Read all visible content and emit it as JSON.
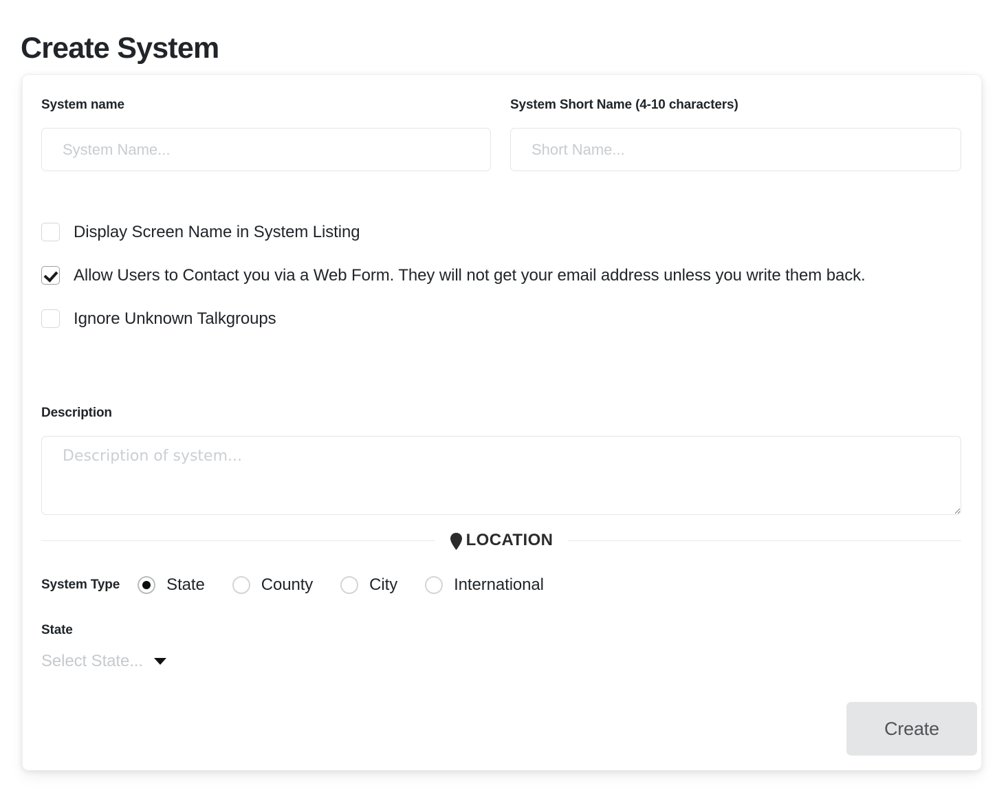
{
  "page": {
    "title": "Create System"
  },
  "form": {
    "system_name": {
      "label": "System name",
      "placeholder": "System Name...",
      "value": ""
    },
    "short_name": {
      "label": "System Short Name (4-10 characters)",
      "placeholder": "Short Name...",
      "value": ""
    },
    "checkboxes": [
      {
        "label": "Display Screen Name in System Listing",
        "checked": false
      },
      {
        "label": "Allow Users to Contact you via a Web Form. They will not get your email address unless you write them back.",
        "checked": true
      },
      {
        "label": "Ignore Unknown Talkgroups",
        "checked": false
      }
    ],
    "description": {
      "label": "Description",
      "placeholder": "Description of system...",
      "value": ""
    },
    "location_divider": {
      "label": "LOCATION",
      "icon": "map-pin-icon"
    },
    "system_type": {
      "label": "System Type",
      "selected": "State",
      "options": [
        "State",
        "County",
        "City",
        "International"
      ]
    },
    "state": {
      "label": "State",
      "placeholder": "Select State...",
      "value": "",
      "caret_icon": "chevron-down-icon"
    },
    "submit": {
      "label": "Create"
    }
  },
  "colors": {
    "page_background": "#ffffff",
    "card_background": "#ffffff",
    "text_primary": "#212529",
    "placeholder": "#c8cccf",
    "border": "#e3e5e7",
    "button_background": "#e3e5e7",
    "button_text": "#4f5458"
  }
}
